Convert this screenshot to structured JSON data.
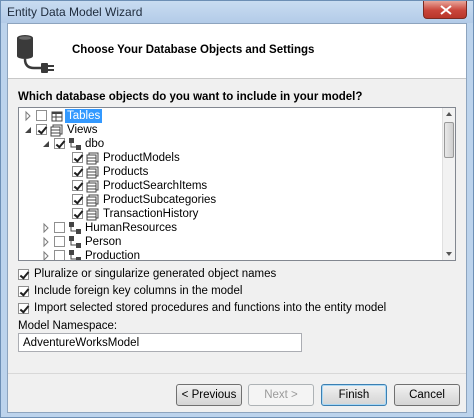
{
  "window": {
    "title": "Entity Data Model Wizard"
  },
  "header": {
    "title": "Choose Your Database Objects and Settings",
    "icon": "database-plug-icon"
  },
  "question": "Which database objects do you want to include in your model?",
  "tree": {
    "rows": [
      {
        "label": "Tables",
        "icon": "tables-icon",
        "checked": false,
        "expanded": false,
        "selected": true
      },
      {
        "label": "Views",
        "icon": "views-icon",
        "checked": true,
        "expanded": true,
        "selected": false
      },
      {
        "label": "dbo",
        "icon": "schema-icon",
        "checked": true,
        "expanded": true,
        "selected": false
      },
      {
        "label": "ProductModels",
        "icon": "view-icon",
        "checked": true
      },
      {
        "label": "Products",
        "icon": "view-icon",
        "checked": true
      },
      {
        "label": "ProductSearchItems",
        "icon": "view-icon",
        "checked": true
      },
      {
        "label": "ProductSubcategories",
        "icon": "view-icon",
        "checked": true
      },
      {
        "label": "TransactionHistory",
        "icon": "view-icon",
        "checked": true
      },
      {
        "label": "HumanResources",
        "icon": "schema-icon",
        "checked": false,
        "expanded": false
      },
      {
        "label": "Person",
        "icon": "schema-icon",
        "checked": false,
        "expanded": false
      },
      {
        "label": "Production",
        "icon": "schema-icon",
        "checked": false,
        "expanded": false
      }
    ]
  },
  "options": {
    "pluralize": {
      "label": "Pluralize or singularize generated object names",
      "checked": true
    },
    "foreign_keys": {
      "label": "Include foreign key columns in the model",
      "checked": true
    },
    "import_procs": {
      "label": "Import selected stored procedures and functions into the entity model",
      "checked": true
    }
  },
  "namespace": {
    "label": "Model Namespace:",
    "value": "AdventureWorksModel"
  },
  "buttons": {
    "previous": "< Previous",
    "next": "Next >",
    "finish": "Finish",
    "cancel": "Cancel"
  }
}
